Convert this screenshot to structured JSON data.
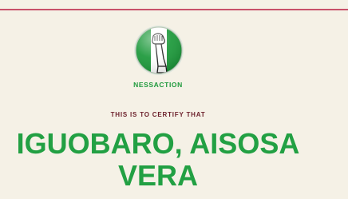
{
  "certificate": {
    "org_name": "NESSACTION",
    "certify_text": "THIS IS TO CERTIFY THAT",
    "recipient_line1": "IGUOBARO, AISOSA",
    "recipient_line2": "VERA"
  },
  "colors": {
    "background": "#f5f1e6",
    "top_rule": "#c8516a",
    "green": "#22a043",
    "dark_text": "#6b1f2a"
  },
  "icons": {
    "logo": "nessaction-fist-flag-logo"
  }
}
